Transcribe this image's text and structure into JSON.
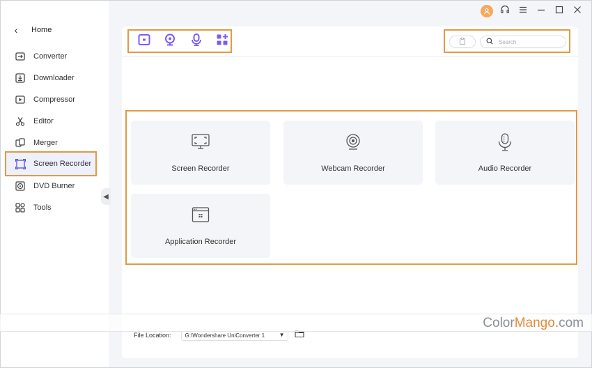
{
  "sidebar": {
    "home_label": "Home",
    "items": [
      {
        "label": "Converter",
        "icon": "converter-icon"
      },
      {
        "label": "Downloader",
        "icon": "downloader-icon"
      },
      {
        "label": "Compressor",
        "icon": "compressor-icon"
      },
      {
        "label": "Editor",
        "icon": "scissors-icon"
      },
      {
        "label": "Merger",
        "icon": "merger-icon"
      },
      {
        "label": "Screen Recorder",
        "icon": "screen-recorder-icon",
        "active": true
      },
      {
        "label": "DVD Burner",
        "icon": "disc-icon"
      },
      {
        "label": "Tools",
        "icon": "tools-grid-icon"
      }
    ]
  },
  "titlebar": {
    "icons": [
      "user-avatar-icon",
      "headset-icon",
      "menu-icon",
      "minimize-icon",
      "maximize-icon",
      "close-icon"
    ]
  },
  "toolbar": {
    "tools": [
      "screen-record-tool-icon",
      "webcam-tool-icon",
      "audio-tool-icon",
      "apps-tool-icon"
    ],
    "accent_color": "#7a5cf0"
  },
  "search": {
    "placeholder": "Search"
  },
  "cards": [
    {
      "label": "Screen Recorder",
      "icon": "screen-recorder-card-icon"
    },
    {
      "label": "Webcam Recorder",
      "icon": "webcam-card-icon"
    },
    {
      "label": "Audio Recorder",
      "icon": "microphone-card-icon"
    },
    {
      "label": "Application Recorder",
      "icon": "application-window-icon"
    }
  ],
  "footer": {
    "file_location_label": "File Location:",
    "path_value": "G:\\Wondershare UniConverter 1"
  },
  "watermark": {
    "part1": "Color",
    "part2": "Mango",
    "part3": ".com"
  },
  "colors": {
    "highlight_border": "#e09a45",
    "accent": "#7a5cf0",
    "avatar": "#f5a95d"
  }
}
